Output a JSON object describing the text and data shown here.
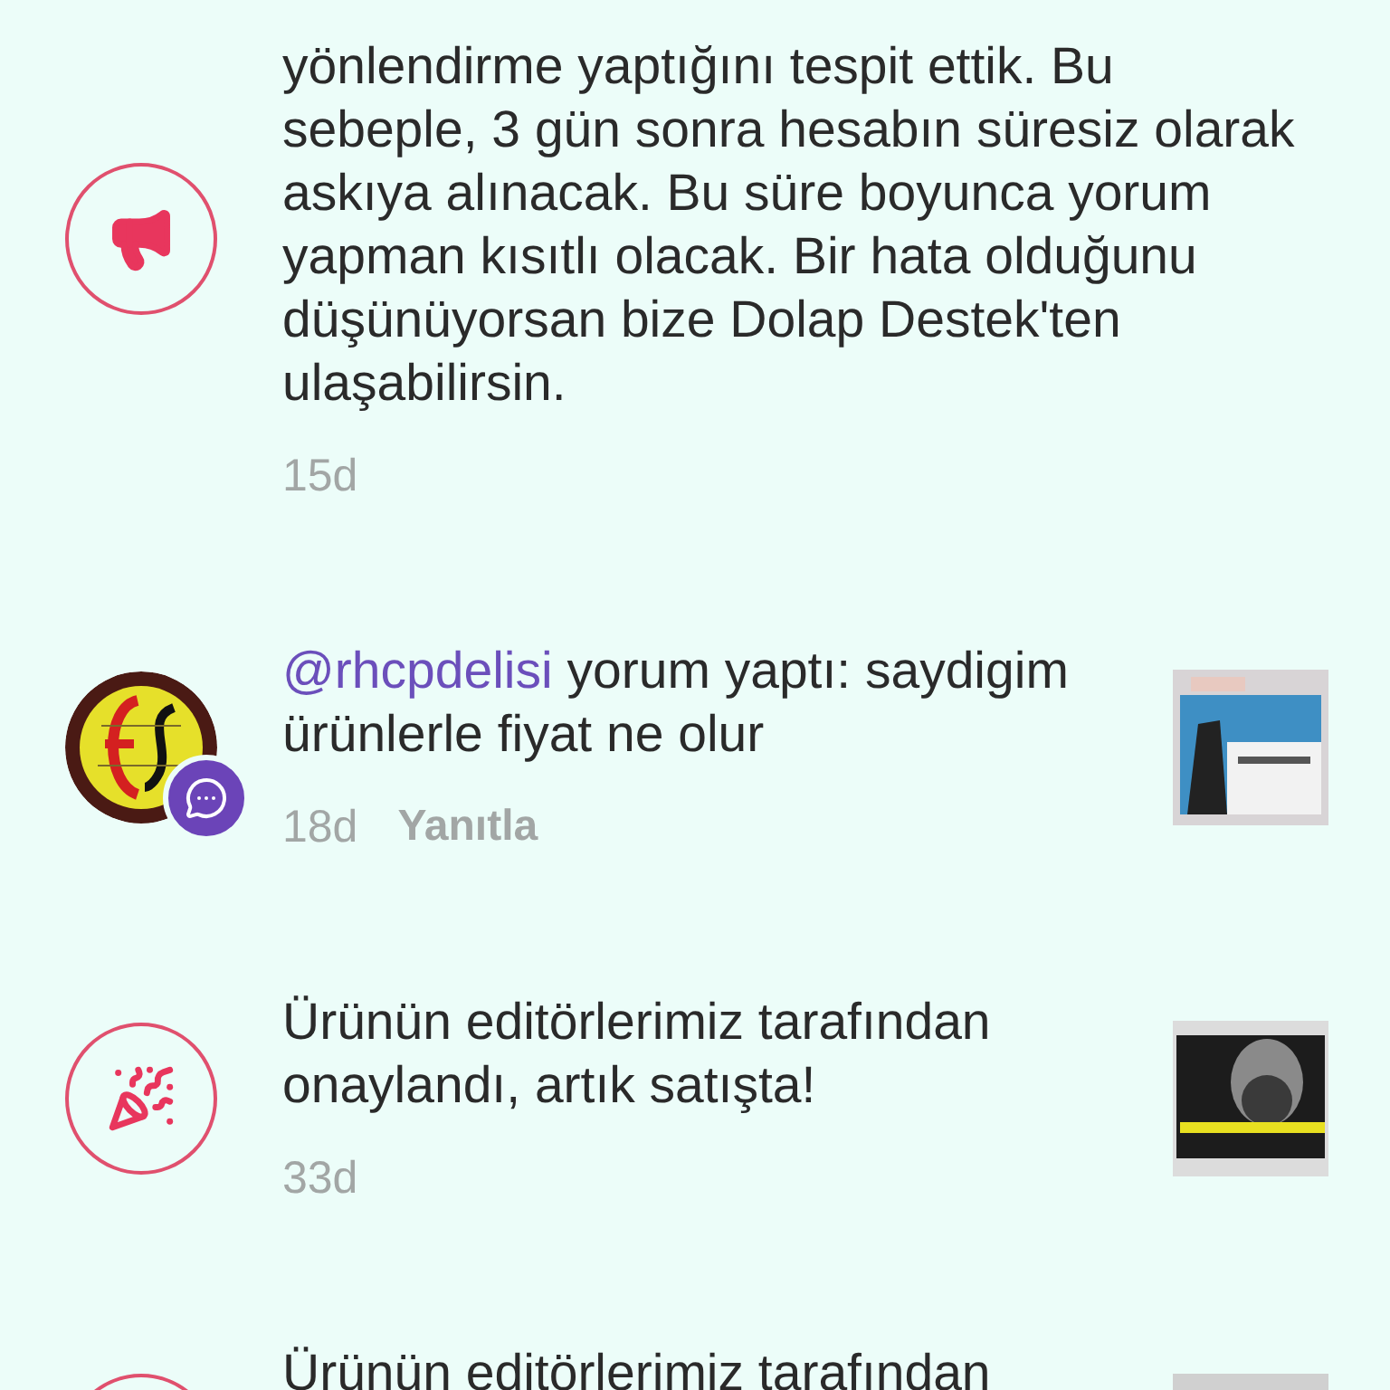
{
  "notifications": [
    {
      "kind": "announcement",
      "lines": [
        "yönlendirme yaptığını tespit ettik. Bu",
        "sebeple, 3 gün sonra hesabın süresiz olarak",
        "askıya alınacak. Bu süre boyunca yorum",
        "yapman kısıtlı olacak. Bir hata olduğunu",
        "düşünüyorsan bize Dolap Destek'ten",
        "ulaşabilirsin."
      ],
      "time": "15d"
    },
    {
      "kind": "comment",
      "mention": "@rhcpdelisi",
      "lines": [
        "yorum yaptı: saydigim",
        "ürünlerle fiyat ne olur"
      ],
      "time": "18d",
      "reply": "Yanıtla",
      "thumbnail": {
        "kind": "picture"
      }
    },
    {
      "kind": "approval",
      "lines": [
        "Ürünün editörlerimiz tarafından",
        "onaylandı, artık satışta!"
      ],
      "time": "33d",
      "thumbnail": {
        "kind": "picture"
      }
    },
    {
      "kind": "approval",
      "lines": [
        "Ürünün editörlerimiz tarafından"
      ],
      "thumbnail": {
        "kind": "picture"
      }
    }
  ]
}
